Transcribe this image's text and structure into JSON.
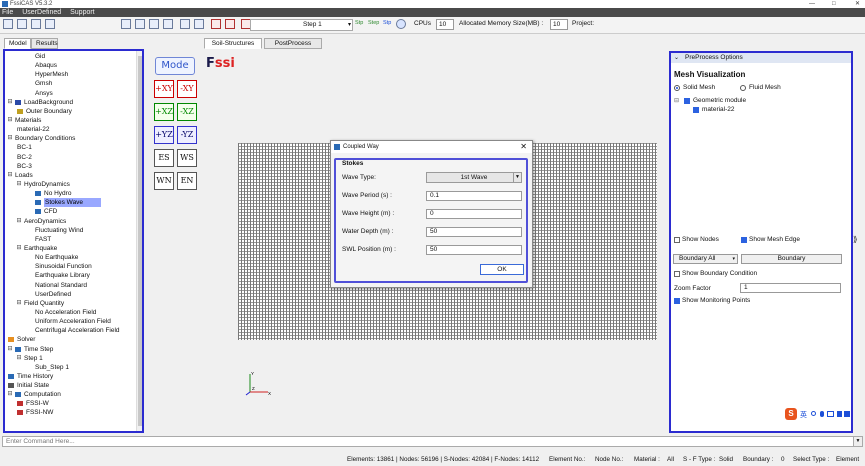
{
  "window": {
    "title": "FssiCAS V5.3.2",
    "controls": [
      "—",
      "□",
      "✕"
    ]
  },
  "menu": [
    "File",
    "UserDefined",
    "Support"
  ],
  "toolbar": {
    "step_label": "Step 1",
    "step_buttons": [
      "Stp",
      "Step",
      "Stp"
    ],
    "cpus_label": "CPUs",
    "cpus_value": "10",
    "memory_label": "Allocated Memory Size(MB) :",
    "memory_value": "10",
    "project_label": "Project:"
  },
  "left_tabs": [
    "Model",
    "Results"
  ],
  "main_tabs": [
    "Soil-Structures",
    "PostProcess"
  ],
  "tree": [
    {
      "label": "Gid",
      "level": 2
    },
    {
      "label": "Abaqus",
      "level": 2
    },
    {
      "label": "HyperMesh",
      "level": 2
    },
    {
      "label": "Gmsh",
      "level": 2
    },
    {
      "label": "Ansys",
      "level": 2
    },
    {
      "label": "LoadBackground",
      "level": 0,
      "exp": "⊟",
      "icon": "filter-icon"
    },
    {
      "label": "Outer Boundary",
      "level": 1,
      "icon": "boundary-icon"
    },
    {
      "label": "Materials",
      "level": 0,
      "exp": "⊟"
    },
    {
      "label": "material-22",
      "level": 1
    },
    {
      "label": "Boundary Conditions",
      "level": 0,
      "exp": "⊟"
    },
    {
      "label": "BC-1",
      "level": 1
    },
    {
      "label": "BC-2",
      "level": 1
    },
    {
      "label": "BC-3",
      "level": 1
    },
    {
      "label": "Loads",
      "level": 0,
      "exp": "⊟"
    },
    {
      "label": "HydroDynamics",
      "level": 1,
      "exp": "⊟"
    },
    {
      "label": "No Hydro",
      "level": 2,
      "icon": "wave-icon"
    },
    {
      "label": "Stokes Wave",
      "level": 2,
      "icon": "wave-icon",
      "selected": true
    },
    {
      "label": "CFD",
      "level": 2,
      "icon": "cfd-icon"
    },
    {
      "label": "AeroDynamics",
      "level": 1,
      "exp": "⊟"
    },
    {
      "label": "Fluctuating Wind",
      "level": 2
    },
    {
      "label": "FAST",
      "level": 2
    },
    {
      "label": "Earthquake",
      "level": 1,
      "exp": "⊟"
    },
    {
      "label": "No Earthquake",
      "level": 2
    },
    {
      "label": "Sinusoidal Function",
      "level": 2
    },
    {
      "label": "Earthquake Library",
      "level": 2
    },
    {
      "label": "National Standard",
      "level": 2
    },
    {
      "label": "UserDefined",
      "level": 2
    },
    {
      "label": "Field Quantity",
      "level": 1,
      "exp": "⊟"
    },
    {
      "label": "No Acceleration Field",
      "level": 2
    },
    {
      "label": "Uniform Acceleration Field",
      "level": 2
    },
    {
      "label": "Centrifugal Acceleration Field",
      "level": 2
    },
    {
      "label": "Solver",
      "level": 0,
      "icon": "solver-icon"
    },
    {
      "label": "Time Step",
      "level": 0,
      "exp": "⊟",
      "icon": "clock-icon"
    },
    {
      "label": "Step 1",
      "level": 1,
      "exp": "⊟"
    },
    {
      "label": "Sub_Step 1",
      "level": 2
    },
    {
      "label": "Time History",
      "level": 0,
      "icon": "history-icon"
    },
    {
      "label": "Initial State",
      "level": 0,
      "icon": "state-icon"
    },
    {
      "label": "Computation",
      "level": 0,
      "exp": "⊟",
      "icon": "computation-icon"
    },
    {
      "label": "FSSI-W",
      "level": 1,
      "icon": "run-icon"
    },
    {
      "label": "FSSI-NW",
      "level": 1,
      "icon": "run-icon"
    }
  ],
  "view_buttons": {
    "modes": "Mode",
    "logo_main": "F",
    "logo_sub": "ssi",
    "grid": [
      {
        "label": "+XY",
        "kind": "red"
      },
      {
        "label": "-XY",
        "kind": "red"
      },
      {
        "label": "+XZ",
        "kind": "grn"
      },
      {
        "label": "-XZ",
        "kind": "grn"
      },
      {
        "label": "+YZ",
        "kind": "blu"
      },
      {
        "label": "-YZ",
        "kind": "blu"
      },
      {
        "label": "ES",
        "kind": "plain"
      },
      {
        "label": "WS",
        "kind": "plain"
      },
      {
        "label": "WN",
        "kind": "plain"
      },
      {
        "label": "EN",
        "kind": "plain"
      }
    ]
  },
  "axes": {
    "y": "Y",
    "z": "Z",
    "x": "X"
  },
  "dialog": {
    "title": "Coupled Way",
    "close": "✕",
    "group_title": "Stokes",
    "wave_type_label": "Wave Type:",
    "wave_type_value": "1st Wave",
    "fields": [
      {
        "label": "Wave Period (s) :",
        "value": "0.1"
      },
      {
        "label": "Wave Height (m) :",
        "value": "0"
      },
      {
        "label": "Water Depth (m) :",
        "value": "50"
      },
      {
        "label": "SWL Position (m) :",
        "value": "50"
      }
    ],
    "ok": "OK"
  },
  "right_panel": {
    "header": "PreProcess Options",
    "mesh_title": "Mesh Visualization",
    "solid_mesh": "Solid Mesh",
    "fluid_mesh": "Fluid Mesh",
    "geometric_module": "Geometric module",
    "material": "material-22",
    "show_nodes": "Show Nodes",
    "show_mesh_edge": "Show Mesh Edge",
    "boundary_select": "Boundary All",
    "boundary_button": "Boundary",
    "show_boundary_condition": "Show Boundary Condition",
    "zoom_label": "Zoom Factor",
    "zoom_value": "1",
    "show_monitoring": "Show Monitoring Points"
  },
  "ime": {
    "s": "S",
    "text": "英"
  },
  "command": {
    "placeholder": "Enter Command Here..."
  },
  "status": [
    "Elements: 13861 | Nodes: 56196 | S-Nodes: 42084 | F-Nodes: 14112",
    "Element No.:",
    "Node No.:",
    "Material :",
    "All",
    "S - F Type :",
    "Solid",
    "Boundary :",
    "0",
    "Select Type :",
    "Element"
  ],
  "colors": {
    "accent": "#2b2bd0",
    "selected": "#99a8ff"
  }
}
